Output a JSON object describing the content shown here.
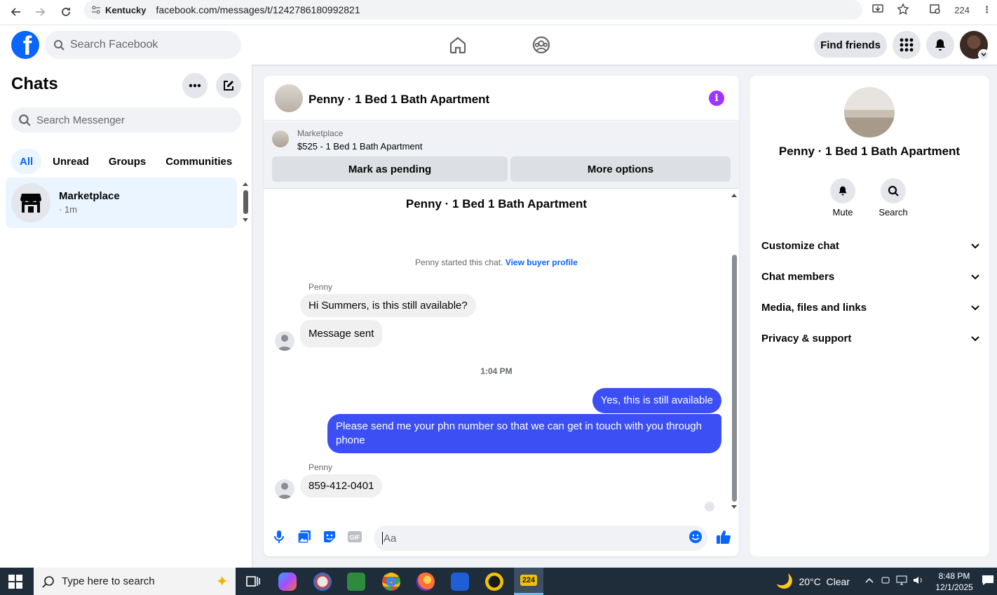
{
  "browser": {
    "site_label": "Kentucky",
    "url": "facebook.com/messages/t/1242786180992821",
    "extension_count": "224"
  },
  "header": {
    "search_placeholder": "Search Facebook",
    "find_friends_label": "Find friends"
  },
  "sidebar": {
    "title": "Chats",
    "search_placeholder": "Search Messenger",
    "filters": [
      "All",
      "Unread",
      "Groups",
      "Communities"
    ],
    "chats": [
      {
        "name": "Marketplace",
        "meta": "· 1m"
      }
    ]
  },
  "conversation": {
    "title": "Penny · 1 Bed 1 Bath Apartment",
    "marketplace_label": "Marketplace",
    "listing": "$525 - 1 Bed 1 Bath Apartment",
    "mark_pending_label": "Mark as pending",
    "more_options_label": "More options",
    "thread_title": "Penny · 1 Bed 1 Bath Apartment",
    "started_text": "Penny started this chat.",
    "buyer_profile_link": "View buyer profile",
    "messages": [
      {
        "sender": "Penny",
        "text": "Hi Summers, is this still available?"
      },
      {
        "text": "Message sent"
      },
      {
        "timestamp": "1:04 PM"
      },
      {
        "text": "Yes, this is still available"
      },
      {
        "text": "Please send me your phn number so that we can get in touch with you through phone"
      },
      {
        "sender": "Penny",
        "text": "859-412-0401"
      }
    ],
    "composer_placeholder": "Aa"
  },
  "info_panel": {
    "name": "Penny · 1 Bed 1 Bath Apartment",
    "mute_label": "Mute",
    "search_label": "Search",
    "sections": [
      "Customize chat",
      "Chat members",
      "Media, files and links",
      "Privacy & support"
    ]
  },
  "taskbar": {
    "search_placeholder": "Type here to search",
    "weather": "20°C  Clear",
    "time": "8:48 PM",
    "date": "12/1/2025",
    "badge": "224"
  },
  "colors": {
    "accent": "#0866ff",
    "outgoing_bubble": "#3b4ff5",
    "info_icon": "#a033ff"
  }
}
